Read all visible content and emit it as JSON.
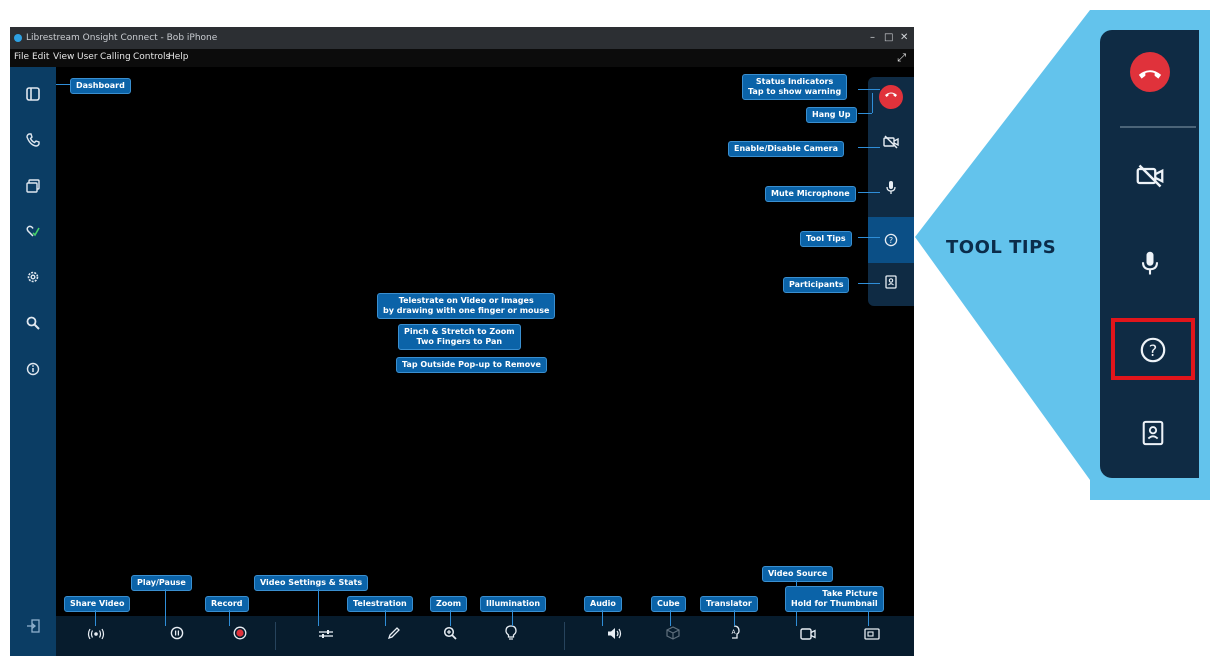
{
  "window": {
    "title": "Librestream Onsight Connect - Bob iPhone",
    "controls": [
      "–",
      "□",
      "✕"
    ]
  },
  "menu": [
    "File",
    "Edit",
    "View",
    "User",
    "Calling",
    "Controls",
    "Help"
  ],
  "sidebar_icons": [
    "dashboard-icon",
    "phone-icon",
    "gallery-icon",
    "heart-check-icon",
    "gear-icon",
    "search-icon",
    "info-icon"
  ],
  "tooltips": {
    "dashboard": "Dashboard",
    "status": "Status Indicators\nTap to show warning",
    "hangup": "Hang Up",
    "camera": "Enable/Disable Camera",
    "mute": "Mute Microphone",
    "tooltips": "Tool Tips",
    "participants": "Participants",
    "telestrate_help": "Telestrate on Video or Images\nby drawing with one finger or mouse",
    "pinch_help": "Pinch & Stretch to Zoom\nTwo Fingers to Pan",
    "tap_help": "Tap Outside Pop-up to Remove",
    "share_video": "Share Video",
    "play_pause": "Play/Pause",
    "record": "Record",
    "video_settings": "Video Settings & Stats",
    "telestration": "Telestration",
    "zoom": "Zoom",
    "illumination": "Illumination",
    "audio": "Audio",
    "cube": "Cube",
    "translator": "Translator",
    "video_source": "Video Source",
    "take_picture": "Take Picture\nHold for Thumbnail"
  },
  "callout": {
    "label": "TOOL TIPS"
  },
  "colors": {
    "hangup_red": "#e0323b",
    "highlight_red": "#e1151b",
    "callout_blue": "#63c3ec",
    "tip_blue": "#0b63a8"
  }
}
